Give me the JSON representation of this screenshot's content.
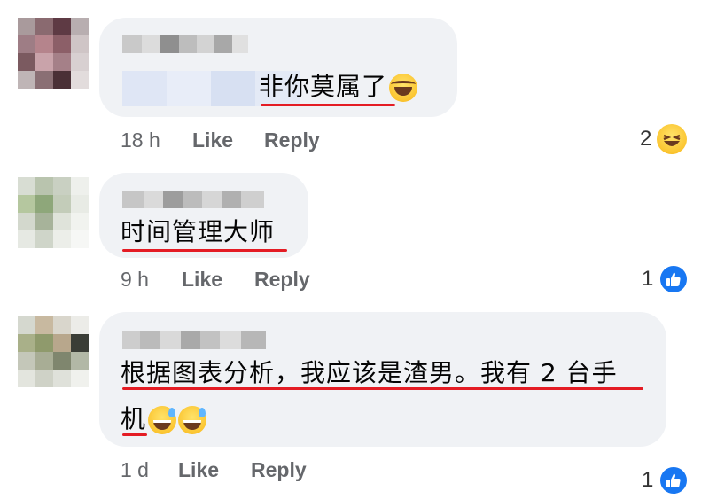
{
  "comments": [
    {
      "text_line1": "非你莫属了",
      "time": "18 h",
      "like_label": "Like",
      "reply_label": "Reply",
      "reaction_count": "2",
      "reaction_icon": "haha-icon"
    },
    {
      "text_line1": "时间管理大师",
      "time": "9 h",
      "like_label": "Like",
      "reply_label": "Reply",
      "reaction_count": "1",
      "reaction_icon": "like-icon"
    },
    {
      "text_line1": "根据图表分析，我应该是渣男。我有 2 台手",
      "text_line2": "机",
      "time": "1 d",
      "like_label": "Like",
      "reply_label": "Reply",
      "reaction_count": "1",
      "reaction_icon": "like-icon"
    }
  ],
  "colors": {
    "bubble_bg": "#f0f2f5",
    "meta_text": "#65676b",
    "underline": "#e41c24",
    "like_blue": "#1877f2"
  }
}
